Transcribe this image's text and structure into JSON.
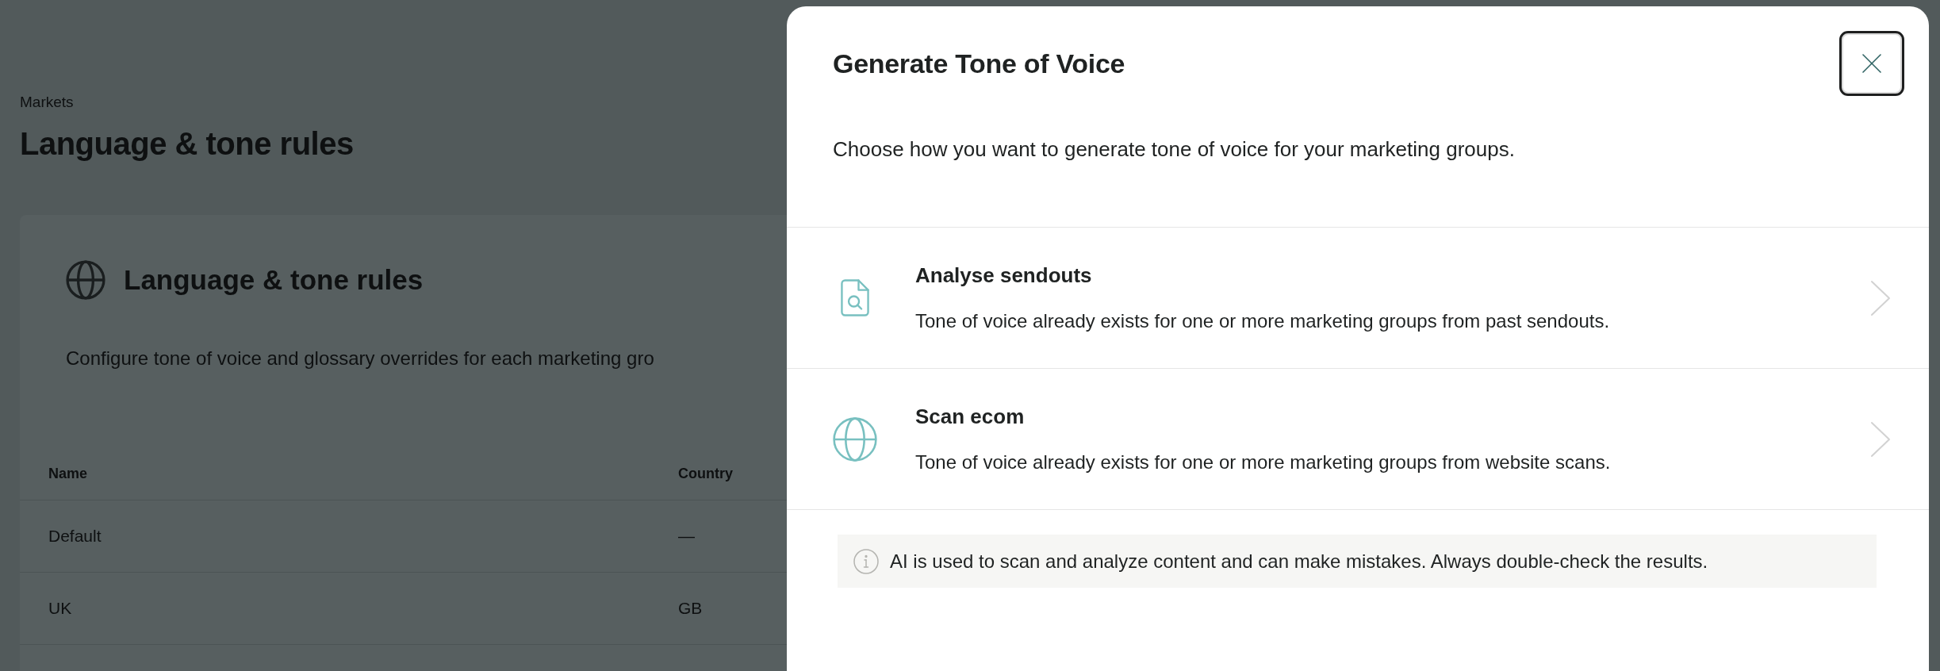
{
  "page": {
    "breadcrumb": "Markets",
    "title": "Language & tone rules",
    "card": {
      "title": "Language & tone rules",
      "description": "Configure tone of voice and glossary overrides for each marketing gro",
      "table": {
        "columns": [
          "Name",
          "Country"
        ],
        "rows": [
          [
            "Default",
            "—"
          ],
          [
            "UK",
            "GB"
          ]
        ]
      }
    }
  },
  "dialog": {
    "title": "Generate Tone of Voice",
    "close_focused": true,
    "subtitle": "Choose how you want to generate tone of voice for your marketing groups.",
    "options": [
      {
        "kind": "document",
        "title": "Analyse sendouts",
        "description": "Tone of voice already exists for one or more marketing groups from past sendouts."
      },
      {
        "kind": "globe",
        "title": "Scan ecom",
        "description": "Tone of voice already exists for one or more marketing groups from website scans."
      }
    ],
    "notice": "AI is used to scan and analyze content and can make mistakes. Always double-check the results."
  }
}
